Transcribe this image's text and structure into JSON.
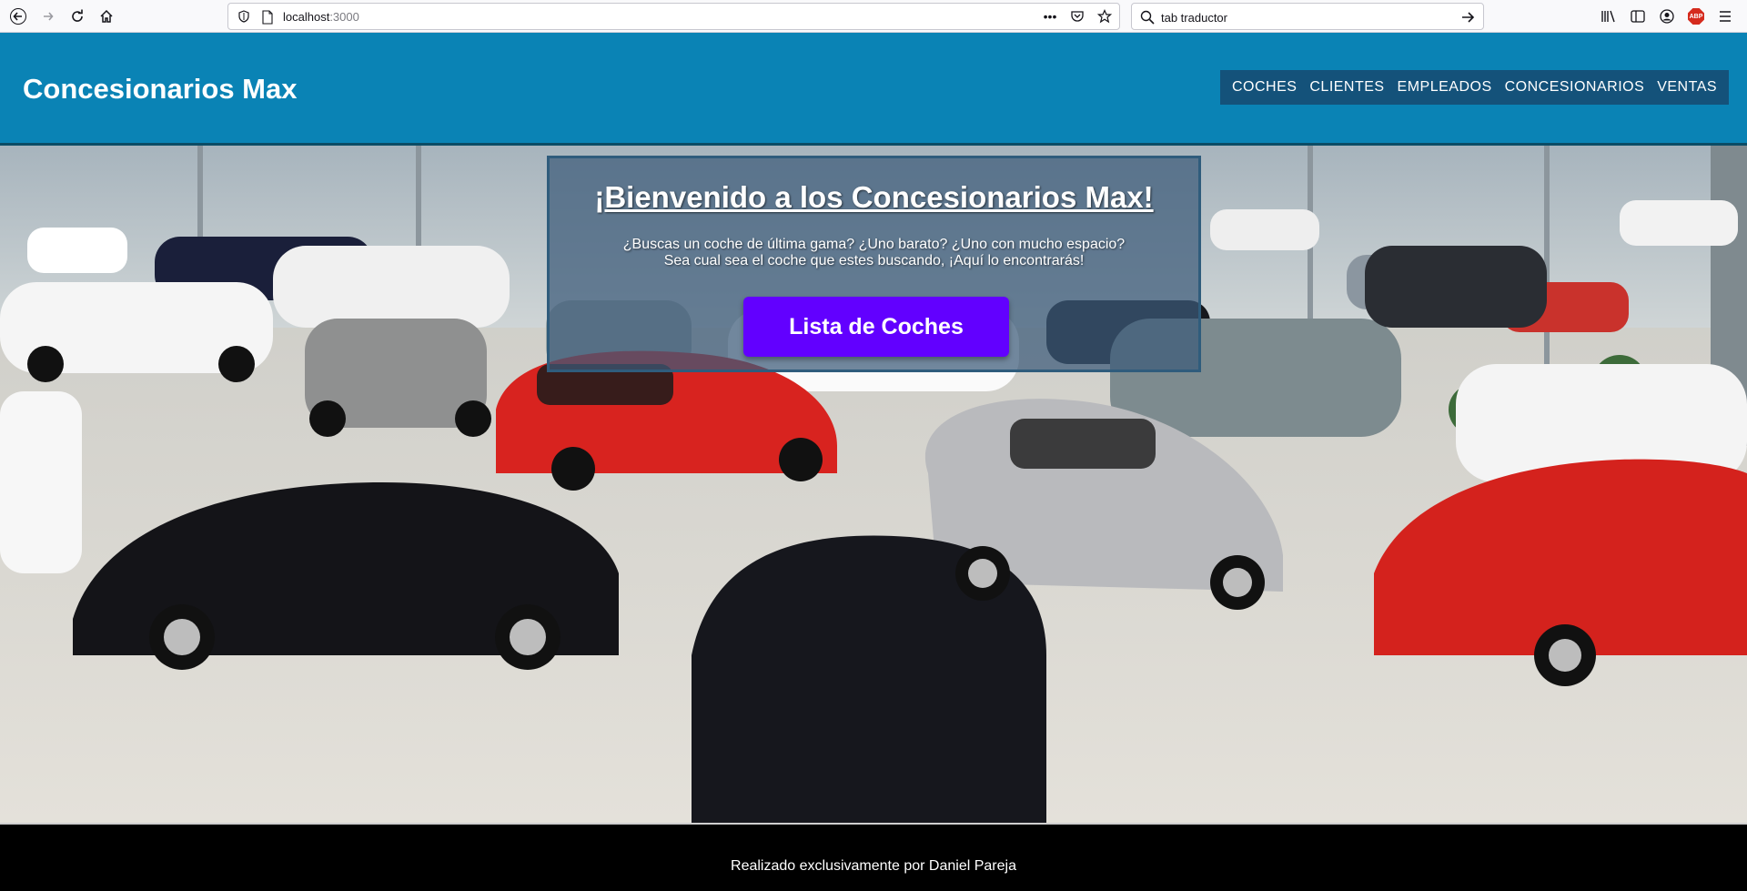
{
  "browser": {
    "url_host": "localhost",
    "url_port": ":3000",
    "search_text": "tab traductor",
    "addon_badge": "ABP"
  },
  "header": {
    "brand": "Concesionarios Max",
    "nav": [
      "COCHES",
      "CLIENTES",
      "EMPLEADOS",
      "CONCESIONARIOS",
      "VENTAS"
    ]
  },
  "hero": {
    "title": "¡Bienvenido a los Concesionarios Max!",
    "line1": "¿Buscas un coche de última gama? ¿Uno barato? ¿Uno con mucho espacio?",
    "line2": "Sea cual sea el coche que estes buscando, ¡Aquí lo encontrarás!",
    "button": "Lista de Coches"
  },
  "footer": {
    "text": "Realizado exclusivamente por Daniel Pareja"
  },
  "colors": {
    "header_bg": "#0a83b5",
    "nav_bg": "#14527a",
    "button_bg": "#6200ff",
    "footer_bg": "#000000"
  }
}
